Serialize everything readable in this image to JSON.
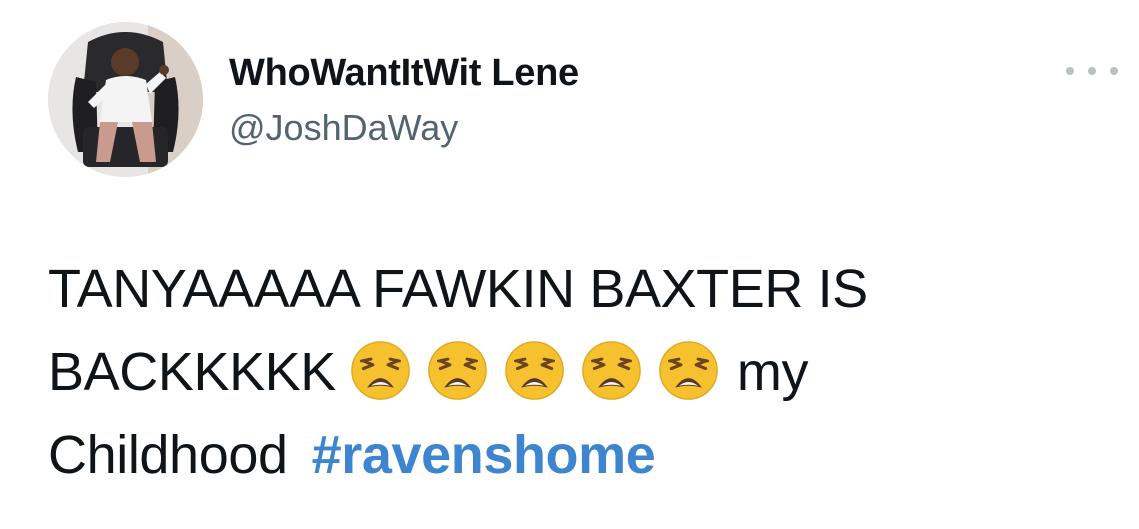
{
  "user": {
    "display_name": "WhoWantItWit Lene",
    "handle": "@JoshDaWay"
  },
  "menu": {
    "icon": "more-horizontal-icon"
  },
  "tweet": {
    "line1": "TANYAAAAA FAWKIN BAXTER IS",
    "line2_start": "BACKKKKK",
    "emoji": [
      "weary-face",
      "weary-face",
      "weary-face",
      "weary-face",
      "weary-face"
    ],
    "line2_end": "my",
    "line3_start": "Childhood",
    "hashtag": "#ravenshome"
  },
  "colors": {
    "text": "#0f1419",
    "handle": "#536471",
    "hashtag": "#3d86cf",
    "emoji_face": "#f5c12e"
  }
}
